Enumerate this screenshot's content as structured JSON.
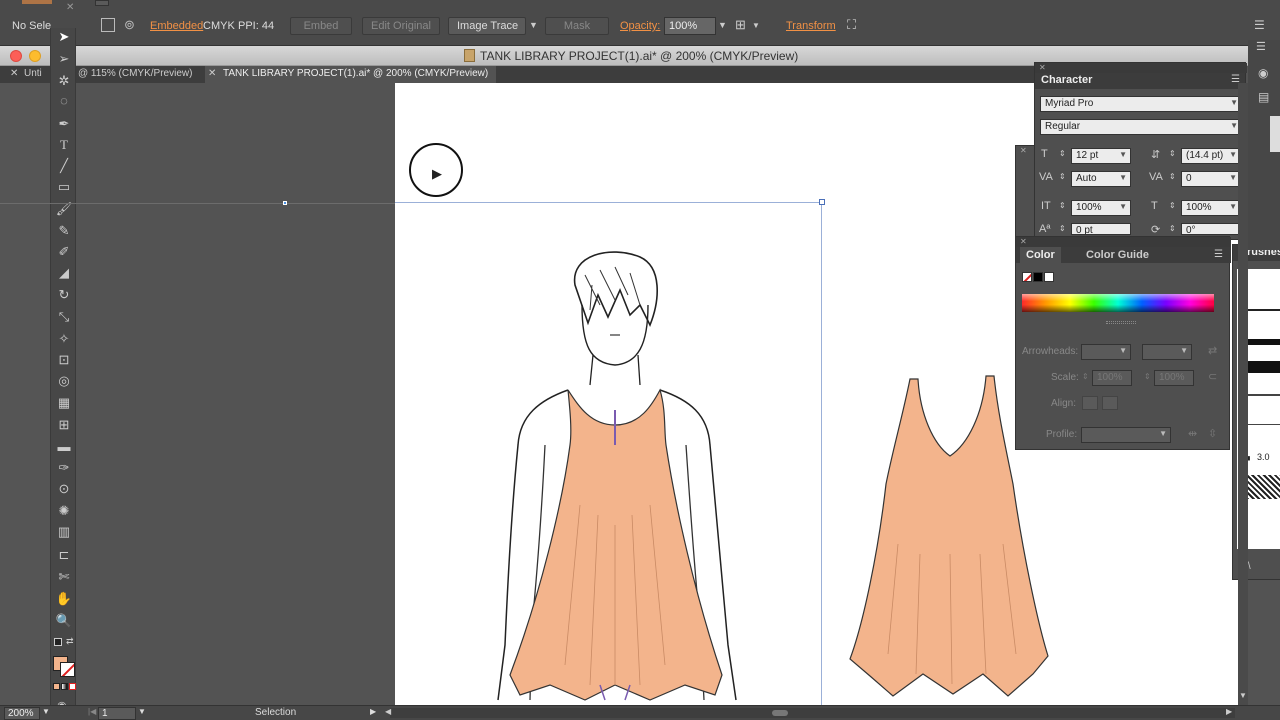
{
  "control_bar": {
    "selection_label": "No Sele",
    "embedded_link": "Embedded",
    "color_mode": "CMYK",
    "ppi": "PPI: 44",
    "embed_button": "Embed",
    "edit_original_button": "Edit Original",
    "image_trace_button": "Image Trace",
    "mask_button": "Mask",
    "opacity_label": "Opacity:",
    "opacity_value": "100%",
    "transform_link": "Transform"
  },
  "window": {
    "title": "TANK LIBRARY PROJECT(1).ai* @ 200% (CMYK/Preview)"
  },
  "tabs": [
    {
      "label": "Unti"
    },
    {
      "label": "@ 115% (CMYK/Preview)"
    },
    {
      "label": "TANK LIBRARY PROJECT(1).ai* @ 200% (CMYK/Preview)"
    }
  ],
  "character_panel": {
    "title": "Character",
    "font_family": "Myriad Pro",
    "font_style": "Regular",
    "font_size": "12 pt",
    "leading": "(14.4 pt)",
    "kerning": "Auto",
    "tracking": "0",
    "vertical_scale": "100%",
    "horizontal_scale": "100%",
    "baseline_shift": "0 pt",
    "rotation": "0°"
  },
  "color_panel": {
    "tab_color": "Color",
    "tab_color_guide": "Color Guide",
    "arrowheads_label": "Arrowheads:",
    "scale_label": "Scale:",
    "scale_value_1": "100%",
    "scale_value_2": "100%",
    "align_label": "Align:",
    "profile_label": "Profile:"
  },
  "brushes_panel": {
    "title": "Brushes",
    "stroke_size": "3.0"
  },
  "status_bar": {
    "zoom": "200%",
    "artboard": "1",
    "tool": "Selection"
  },
  "colors": {
    "fill_color": "#f3b48c",
    "accent_orange": "#f29145"
  }
}
